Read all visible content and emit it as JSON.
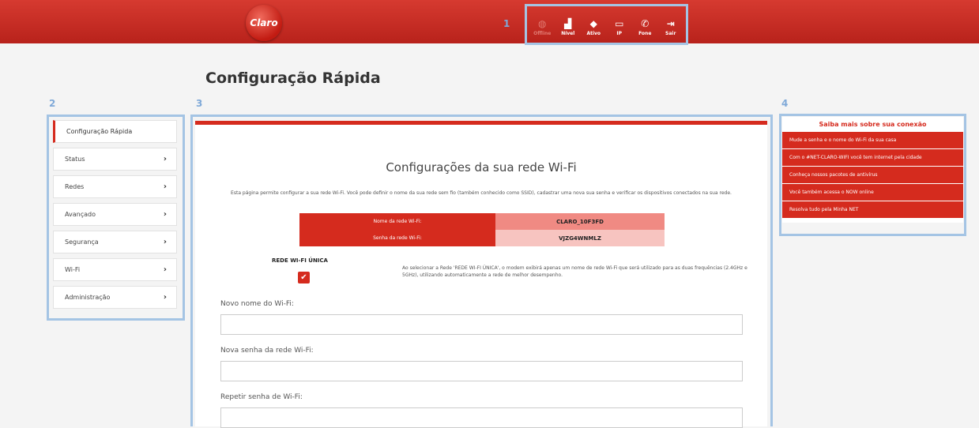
{
  "header": {
    "logo_text": "Claro",
    "status_items": [
      {
        "icon": "globe-icon",
        "glyph": "◍",
        "label": "Offline",
        "dim": true
      },
      {
        "icon": "signal-icon",
        "glyph": "▟",
        "label": "Nível",
        "dim": false
      },
      {
        "icon": "wifi-icon",
        "glyph": "◆",
        "label": "Ativo",
        "dim": false
      },
      {
        "icon": "monitor-icon",
        "glyph": "▭",
        "label": "IP",
        "dim": false
      },
      {
        "icon": "phone-icon",
        "glyph": "✆",
        "label": "Fone",
        "dim": false
      },
      {
        "icon": "logout-icon",
        "glyph": "⇥",
        "label": "Sair",
        "dim": false
      }
    ]
  },
  "annotations": [
    "1",
    "2",
    "3",
    "4"
  ],
  "page_title": "Configuração Rápida",
  "sidebar": {
    "items": [
      {
        "label": "Configuração Rápida",
        "active": true
      },
      {
        "label": "Status",
        "active": false
      },
      {
        "label": "Redes",
        "active": false
      },
      {
        "label": "Avançado",
        "active": false
      },
      {
        "label": "Segurança",
        "active": false
      },
      {
        "label": "Wi-Fi",
        "active": false
      },
      {
        "label": "Administração",
        "active": false
      }
    ]
  },
  "main": {
    "title": "Configurações da sua rede Wi-Fi",
    "description": "Esta página permite configurar a sua rede Wi-Fi. Você pode definir o nome da sua rede sem fio (também conhecido como SSID), cadastrar uma nova sua senha e verificar os dispositivos conectados na sua rede.",
    "wifi_name_label": "Nome da rede Wi-Fi:",
    "wifi_name_value": "CLARO_10F3FD",
    "wifi_pass_label": "Senha da rede Wi-Fi:",
    "wifi_pass_value": "VJZG4WNMLZ",
    "single_network_label": "REDE WI-FI ÚNICA",
    "single_network_checked": true,
    "single_network_desc": "Ao selecionar a Rede 'REDE WI-FI ÚNICA', o modem exibirá apenas um nome de rede Wi-Fi que será utilizado para as duas frequências (2.4GHz e 5GHz), utilizando automaticamente a rede de melhor desempenho.",
    "new_name_label": "Novo nome do Wi-Fi:",
    "new_pass_label": "Nova senha da rede Wi-Fi:",
    "repeat_pass_label": "Repetir senha de Wi-Fi:"
  },
  "right_panel": {
    "title": "Saiba mais sobre sua conexão",
    "links": [
      "Mude a senha e o nome do Wi-Fi da sua casa",
      "Com o #NET-CLARO-WIFI você tem internet pela cidade",
      "Conheça nossos pacotes de antivírus",
      "Você também acessa o NOW online",
      "Resolva tudo pela Minha NET"
    ]
  },
  "colors": {
    "brand_red": "#d52b1e",
    "annotation_blue": "#a4c4e4"
  }
}
